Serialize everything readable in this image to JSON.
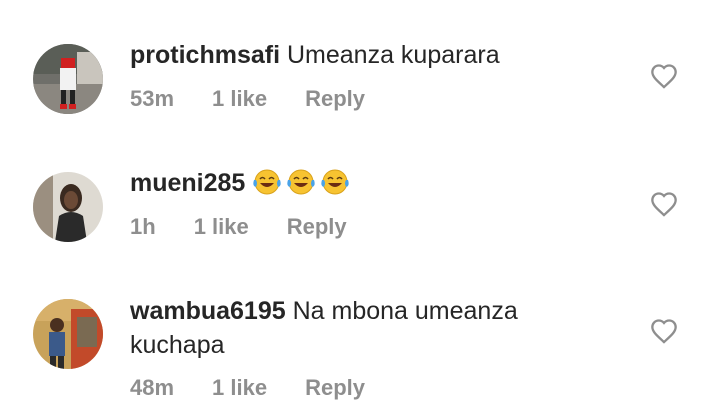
{
  "comments": [
    {
      "username": "protichmsafi",
      "text": "Umeanza kuparara",
      "time": "53m",
      "likes": "1 like",
      "reply": "Reply"
    },
    {
      "username": "mueni285",
      "text": "",
      "emoji": [
        "face-with-tears-of-joy",
        "face-with-tears-of-joy",
        "face-with-tears-of-joy"
      ],
      "time": "1h",
      "likes": "1 like",
      "reply": "Reply"
    },
    {
      "username": "wambua6195",
      "text": "Na mbona umeanza kuchapa",
      "time": "48m",
      "likes": "1 like",
      "reply": "Reply"
    }
  ],
  "icons": {
    "like": "heart-outline-icon"
  },
  "colors": {
    "text": "#262626",
    "meta": "#8e8e8e"
  }
}
